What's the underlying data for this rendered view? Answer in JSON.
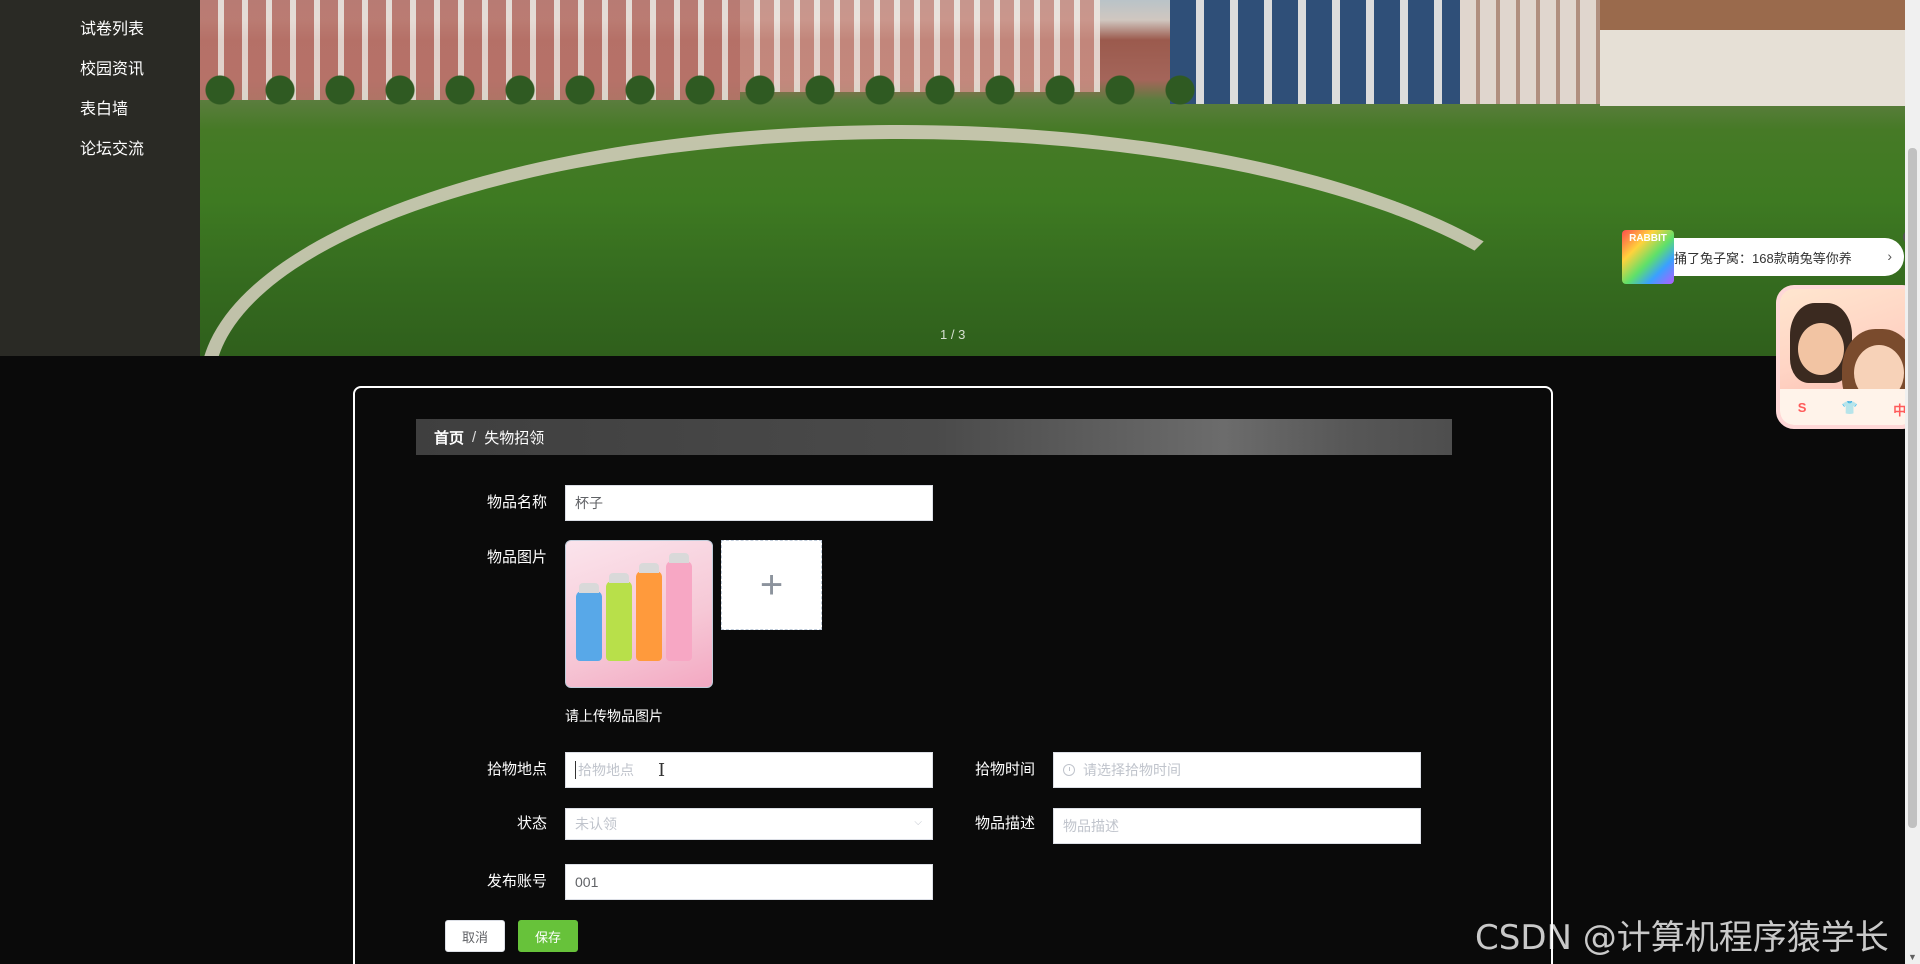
{
  "sidebar": {
    "items": [
      {
        "label": "试卷列表"
      },
      {
        "label": "校园资讯"
      },
      {
        "label": "表白墙"
      },
      {
        "label": "论坛交流"
      }
    ]
  },
  "banner": {
    "slide_indicator": "1 / 3"
  },
  "ads": {
    "banner_logo_text": "RABBIT",
    "banner_text": "捅了兔子窝：168款萌兔等你养",
    "close_icon": "close-icon",
    "card_controls": [
      "S",
      "👕",
      "中"
    ]
  },
  "breadcrumb": {
    "home": "首页",
    "separator": "/",
    "current": "失物招领"
  },
  "form": {
    "item_name": {
      "label": "物品名称",
      "value": "杯子"
    },
    "item_image": {
      "label": "物品图片",
      "hint": "请上传物品图片"
    },
    "pickup_location": {
      "label": "拾物地点",
      "placeholder": "拾物地点"
    },
    "pickup_time": {
      "label": "拾物时间",
      "placeholder": "请选择拾物时间"
    },
    "status": {
      "label": "状态",
      "selected": "未认领"
    },
    "description": {
      "label": "物品描述",
      "placeholder": "物品描述"
    },
    "publisher_account": {
      "label": "发布账号",
      "value": "001"
    },
    "cancel_label": "取消",
    "save_label": "保存"
  },
  "watermark": "CSDN @计算机程序猿学长",
  "colors": {
    "page_bg": "#0a0a0a",
    "sidebar_bg": "#2a2a25",
    "save_button": "#67c23a",
    "panel_border": "#ffffff"
  }
}
